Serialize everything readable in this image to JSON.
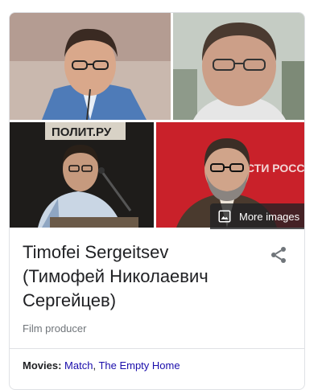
{
  "knowledge_panel": {
    "more_images_label": "More images",
    "title_line1": "Timofei Sergeitsev",
    "title_line2": "(Тимофей Николаевич",
    "title_line3": "Сергейцев)",
    "subtitle": "Film producer",
    "movies_label": "Movies:",
    "movies": [
      "Match",
      "The Empty Home"
    ],
    "movies_separator": ", ",
    "photo_sign_text": "ПОЛИТ.РУ",
    "photo_backdrop_text": "СТИ РОССИ"
  },
  "colors": {
    "link": "#1a0dab",
    "title": "#202124",
    "subtitle": "#70757a",
    "border": "#dfe1e5"
  }
}
